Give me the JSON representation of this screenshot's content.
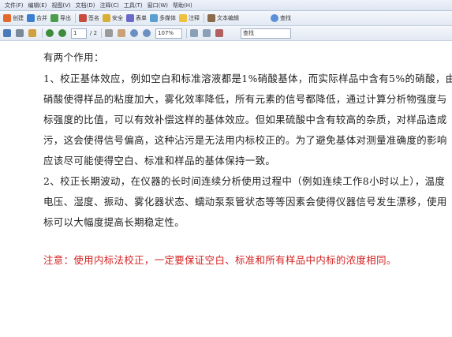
{
  "menubar": {
    "items": [
      "文件(F)",
      "编辑(E)",
      "视图(V)",
      "文档(D)",
      "注释(C)",
      "工具(T)",
      "窗口(W)",
      "帮助(H)"
    ]
  },
  "toolbar1": {
    "buttons": [
      "创建",
      "合并",
      "导出",
      "签名",
      "安全",
      "表单",
      "多媒体",
      "注释"
    ],
    "text_edit_label": "文本编辑",
    "find_label": "查找"
  },
  "toolbar2": {
    "page_number": "1",
    "page_total": "/ 2",
    "zoom": "107%",
    "search_placeholder": "查找"
  },
  "document": {
    "lines": [
      "有两个作用：",
      "1、校正基体效应，例如空白和标准溶液都是1%硝酸基体，而实际样品中含有5%的硝酸，由",
      "硝酸使得样品的粘度加大，雾化效率降低，所有元素的信号都降低，通过计算分析物强度与",
      "标强度的比值，可以有效补偿这样的基体效应。但如果硫酸中含有较高的杂质，对样品造成",
      "污，这会使得信号偏高，这种沾污是无法用内标校正的。为了避免基体对测量准确度的影响",
      "应该尽可能使得空白、标准和样品的基体保持一致。",
      "2、校正长期波动，在仪器的长时间连续分析使用过程中（例如连续工作8小时以上），温度",
      "电压、湿度、振动、雾化器状态、蠕动泵泵管状态等等因素会使得仪器信号发生漂移，使用",
      "标可以大幅度提高长期稳定性。"
    ],
    "note": "注意：使用内标法校正，一定要保证空白、标准和所有样品中内标的浓度相同。"
  }
}
